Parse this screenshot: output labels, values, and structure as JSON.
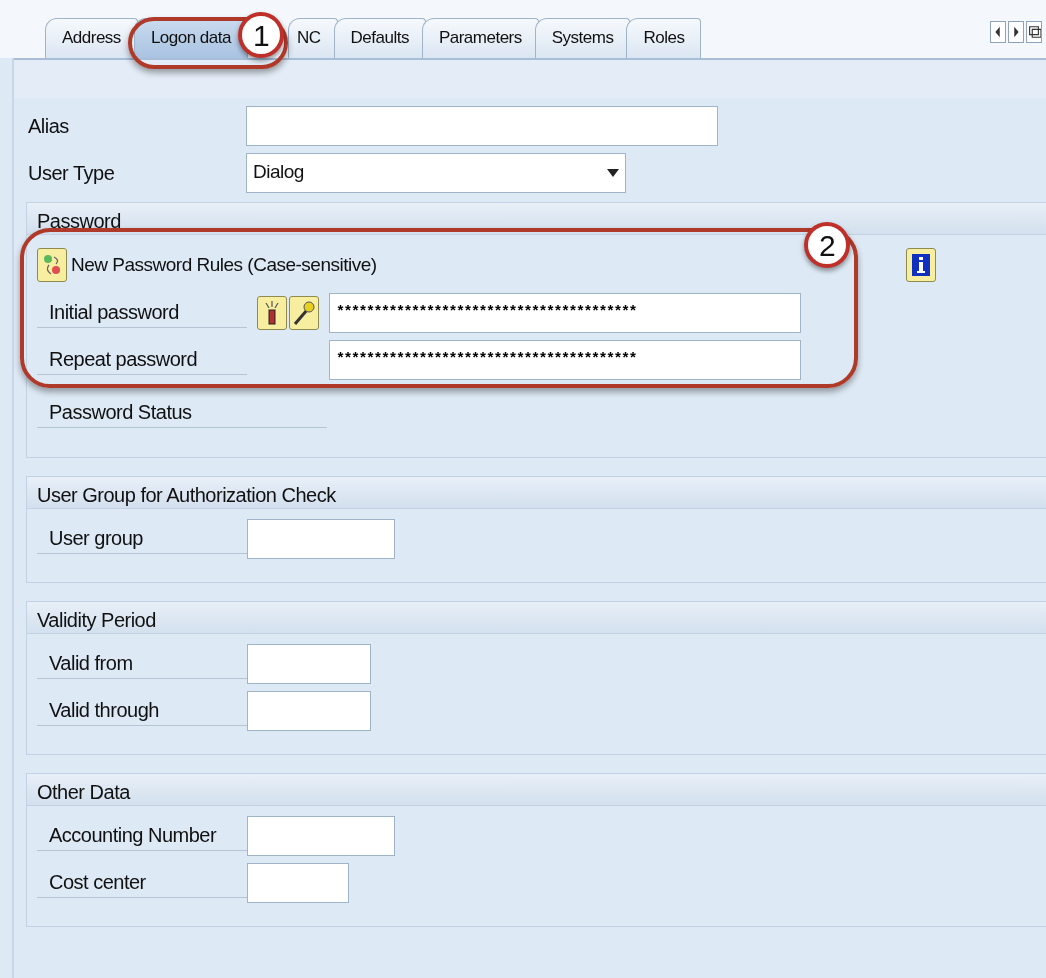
{
  "tabs": [
    {
      "label": "Address",
      "selected": false
    },
    {
      "label": "Logon data",
      "selected": true
    },
    {
      "label": "NC",
      "selected": false
    },
    {
      "label": "Defaults",
      "selected": false
    },
    {
      "label": "Parameters",
      "selected": false
    },
    {
      "label": "Systems",
      "selected": false
    },
    {
      "label": "Roles",
      "selected": false
    }
  ],
  "top_fields": [
    {
      "kind": "text",
      "label": "Alias"
    },
    {
      "kind": "dropdown",
      "label": "User Type",
      "value": "Dialog"
    }
  ],
  "sections": [
    {
      "title": "Password",
      "rules_text": "New Password Rules (Case-sensitive)",
      "fields": [
        {
          "kind": "password",
          "label": "Initial password",
          "value": "****************************************",
          "tools": true
        },
        {
          "kind": "password",
          "label": "Repeat password",
          "value": "****************************************",
          "tools": false
        },
        {
          "kind": "status",
          "label": "Password Status"
        }
      ]
    },
    {
      "title": "User Group for Authorization Check",
      "fields": [
        {
          "kind": "text",
          "label": "User group"
        }
      ]
    },
    {
      "title": "Validity Period",
      "fields": [
        {
          "kind": "text",
          "label": "Valid from"
        },
        {
          "kind": "text",
          "label": "Valid through"
        }
      ]
    },
    {
      "title": "Other Data",
      "fields": [
        {
          "kind": "text",
          "label": "Accounting Number"
        },
        {
          "kind": "text",
          "label": "Cost center"
        }
      ]
    }
  ],
  "annotations": [
    {
      "label": "1"
    },
    {
      "label": "2"
    }
  ]
}
